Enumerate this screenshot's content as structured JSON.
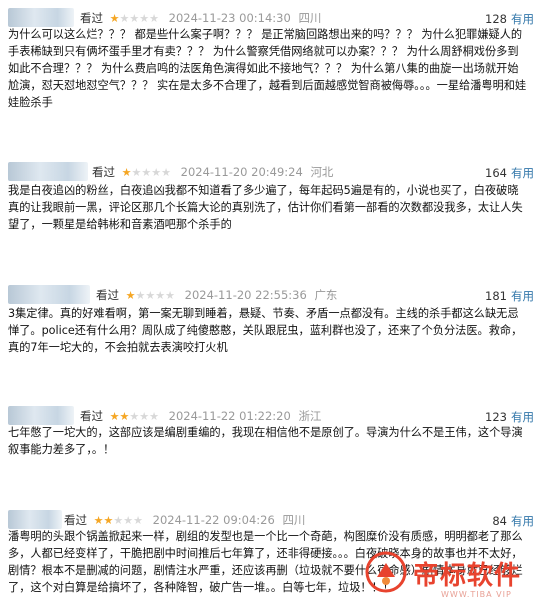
{
  "reviews": [
    {
      "status": "看过",
      "rating": 1,
      "date": "2024-11-23 00:14:30",
      "location": "四川",
      "votes": "128",
      "useful_label": "有用",
      "text": "为什么可以这么烂？？？ 都是些什么案子啊？？？ 是正常脑回路想出来的吗？？？ 为什么犯罪嫌疑人的手表稀缺到只有俩坏蛋手里才有卖？？？ 为什么警察凭借网络就可以办案？？？ 为什么周舒桐戏份多到如此不合理？？？ 为什么费启鸣的法医角色演得如此不接地气？？？ 为什么第八集的曲旋一出场就开始尬演，怼天怼地怼空气？？？ 实在是太多不合理了，越看到后面越感觉智商被侮辱。。。一星给潘粤明和娃娃脸杀手"
    },
    {
      "status": "看过",
      "rating": 1,
      "date": "2024-11-20 20:49:24",
      "location": "河北",
      "votes": "164",
      "useful_label": "有用",
      "text": "我是白夜追凶的粉丝，白夜追凶我都不知道看了多少遍了，每年起码5遍是有的，小说也买了，白夜破晓真的让我眼前一黑，评论区那几个长篇大论的真别洗了，估计你们看第一部看的次数都没我多，太让人失望了，一颗星是给韩彬和音素酒吧那个杀手的"
    },
    {
      "status": "看过",
      "rating": 1,
      "date": "2024-11-20 22:55:36",
      "location": "广东",
      "votes": "181",
      "useful_label": "有用",
      "text": "3集定律。真的好难看啊，第一案无聊到睡着，悬疑、节奏、矛盾一点都没有。主线的杀手都这么缺无忌惮了。police还有什么用？周队成了纯傻憨憨，关队跟屁虫，蓝利群也没了，还来了个负分法医。救命，真的7年一坨大的，不会拍就去表演咬打火机"
    },
    {
      "status": "看过",
      "rating": 2,
      "date": "2024-11-22 01:22:20",
      "location": "浙江",
      "votes": "123",
      "useful_label": "有用",
      "text": "七年憋了一坨大的，这部应该是编剧重编的，我现在相信他不是原创了。导演为什么不是王伟，这个导演叙事能力差多了，。！"
    },
    {
      "status": "看过",
      "rating": 2,
      "date": "2024-11-22 09:04:26",
      "location": "四川",
      "votes": "84",
      "useful_label": "有用",
      "text": "潘粤明的头跟个锅盖掀起来一样，剧组的发型也是一个比一个奇葩，构图糜价没有质感，明明都老了那么多，人都已经变样了，干脆把剧中时间推后七年算了，还非得硬接。。。白夜破晓本身的故事也并不太好，剧情？根本不是删减的问题，剧情注水严重，还应该再删（垃圾就不要什么宿命感）剧情本身就已经够烂了，这个对白算是给搞坏了，各种降智，破广告一堆。。白等七年，垃圾！！！"
    }
  ],
  "watermark": {
    "brand": "帝标软件",
    "sub": "WWW.TIBA VIP",
    "color": "#e8432e"
  }
}
